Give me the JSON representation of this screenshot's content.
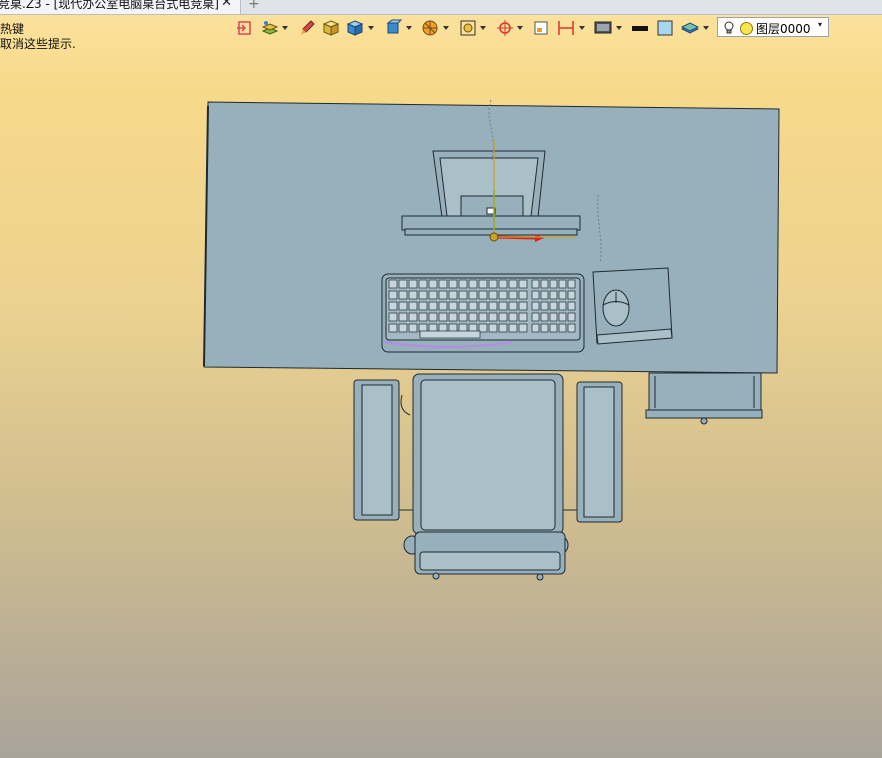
{
  "window": {
    "tab_title": "竞桌.Z3 - [现代办公室电脑桌台式电竞桌]",
    "close_glyph": "✕",
    "new_tab_glyph": "+"
  },
  "hints": {
    "line1": "热键",
    "line2": "取消这些提示."
  },
  "toolbar": {
    "items": [
      "exit-icon",
      "layers-icon",
      "brush-icon",
      "shaded-cube-icon",
      "cube-icon",
      "view-cube-icon",
      "section-icon",
      "zoom-fit-icon",
      "pan-icon",
      "frame-icon",
      "dimension-icon",
      "display-icon",
      "line-color-icon",
      "fill-color-icon",
      "plane-icon"
    ],
    "layer_label": "图层0000",
    "layer_dropdown_glyph": "▾"
  },
  "colors": {
    "model": "#97b0bb",
    "edge": "#1e2a30",
    "accent_purple": "#b28ce6"
  }
}
